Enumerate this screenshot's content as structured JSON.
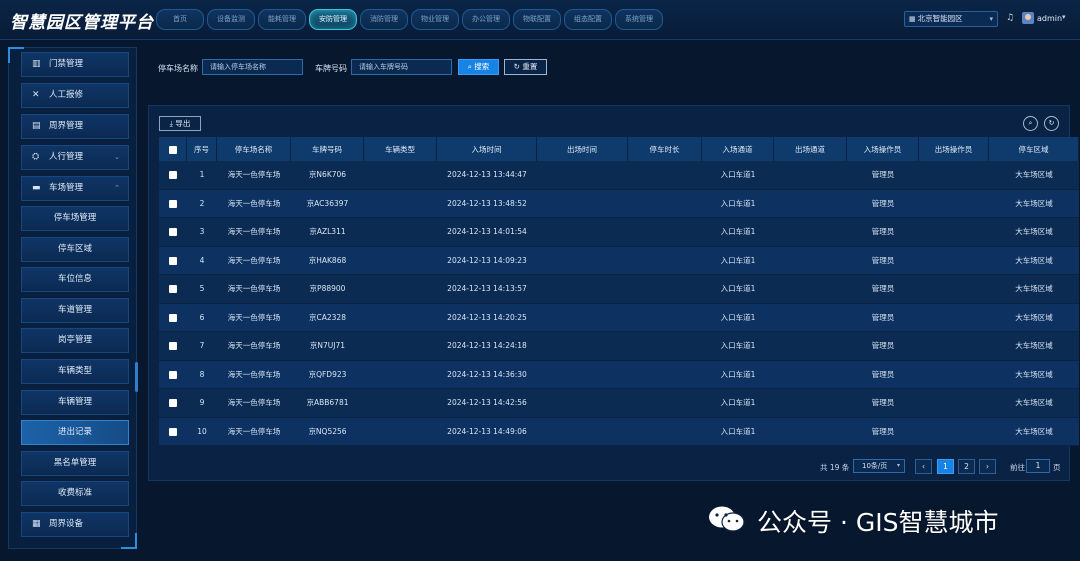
{
  "app": {
    "title": "智慧园区管理平台"
  },
  "nav": {
    "items": [
      "首页",
      "设备监测",
      "能耗管理",
      "安防管理",
      "消防管理",
      "物业管理",
      "办公管理",
      "物联配置",
      "组态配置",
      "系统管理"
    ],
    "active_index": 3
  },
  "header": {
    "region": "北京智能园区",
    "username": "admin"
  },
  "sidebar": {
    "top_items": [
      {
        "label": "门禁管理",
        "icon": "door-icon"
      },
      {
        "label": "人工报修",
        "icon": "wrench-icon"
      },
      {
        "label": "周界管理",
        "icon": "fence-icon"
      },
      {
        "label": "人行管理",
        "icon": "pedestrian-icon"
      },
      {
        "label": "车场管理",
        "icon": "car-icon"
      }
    ],
    "sub_items": [
      "停车场管理",
      "停车区域",
      "车位信息",
      "车道管理",
      "岗亭管理",
      "车辆类型",
      "车辆管理",
      "进出记录",
      "黑名单管理",
      "收费标准"
    ],
    "active_sub_index": 7,
    "bottom_item": {
      "label": "周界设备",
      "icon": "device-icon"
    }
  },
  "filters": {
    "parking_name_label": "停车场名称",
    "parking_name_placeholder": "请输入停车场名称",
    "plate_label": "车牌号码",
    "plate_placeholder": "请输入车牌号码",
    "search_label": "搜索",
    "reset_label": "重置"
  },
  "toolbar": {
    "export_label": "导出"
  },
  "table": {
    "columns": [
      "序号",
      "停车场名称",
      "车牌号码",
      "车辆类型",
      "入场时间",
      "出场时间",
      "停车时长",
      "入场通道",
      "出场通道",
      "入场操作员",
      "出场操作员",
      "停车区域"
    ],
    "rows": [
      [
        "1",
        "海天一色停车场",
        "京N6K706",
        "",
        "2024-12-13 13:44:47",
        "",
        "",
        "入口车道1",
        "",
        "管理员",
        "",
        "大车场区域"
      ],
      [
        "2",
        "海天一色停车场",
        "京AC36397",
        "",
        "2024-12-13 13:48:52",
        "",
        "",
        "入口车道1",
        "",
        "管理员",
        "",
        "大车场区域"
      ],
      [
        "3",
        "海天一色停车场",
        "京AZL311",
        "",
        "2024-12-13 14:01:54",
        "",
        "",
        "入口车道1",
        "",
        "管理员",
        "",
        "大车场区域"
      ],
      [
        "4",
        "海天一色停车场",
        "京HAK868",
        "",
        "2024-12-13 14:09:23",
        "",
        "",
        "入口车道1",
        "",
        "管理员",
        "",
        "大车场区域"
      ],
      [
        "5",
        "海天一色停车场",
        "京P88900",
        "",
        "2024-12-13 14:13:57",
        "",
        "",
        "入口车道1",
        "",
        "管理员",
        "",
        "大车场区域"
      ],
      [
        "6",
        "海天一色停车场",
        "京CA2328",
        "",
        "2024-12-13 14:20:25",
        "",
        "",
        "入口车道1",
        "",
        "管理员",
        "",
        "大车场区域"
      ],
      [
        "7",
        "海天一色停车场",
        "京N7UJ71",
        "",
        "2024-12-13 14:24:18",
        "",
        "",
        "入口车道1",
        "",
        "管理员",
        "",
        "大车场区域"
      ],
      [
        "8",
        "海天一色停车场",
        "京QFD923",
        "",
        "2024-12-13 14:36:30",
        "",
        "",
        "入口车道1",
        "",
        "管理员",
        "",
        "大车场区域"
      ],
      [
        "9",
        "海天一色停车场",
        "京ABB6781",
        "",
        "2024-12-13 14:42:56",
        "",
        "",
        "入口车道1",
        "",
        "管理员",
        "",
        "大车场区域"
      ],
      [
        "10",
        "海天一色停车场",
        "京NQ5256",
        "",
        "2024-12-13 14:49:06",
        "",
        "",
        "入口车道1",
        "",
        "管理员",
        "",
        "大车场区域"
      ]
    ]
  },
  "pagination": {
    "total_text": "共 19 条",
    "page_size": "10条/页",
    "pages": [
      "1",
      "2"
    ],
    "current_page": "1",
    "goto_label": "前往",
    "goto_value": "1",
    "page_suffix": "页"
  },
  "watermark": {
    "text": "公众号 · GIS智慧城市"
  },
  "colors": {
    "accent": "#1783e6",
    "background": "#07172e",
    "nav_active": "#35c7dc"
  }
}
